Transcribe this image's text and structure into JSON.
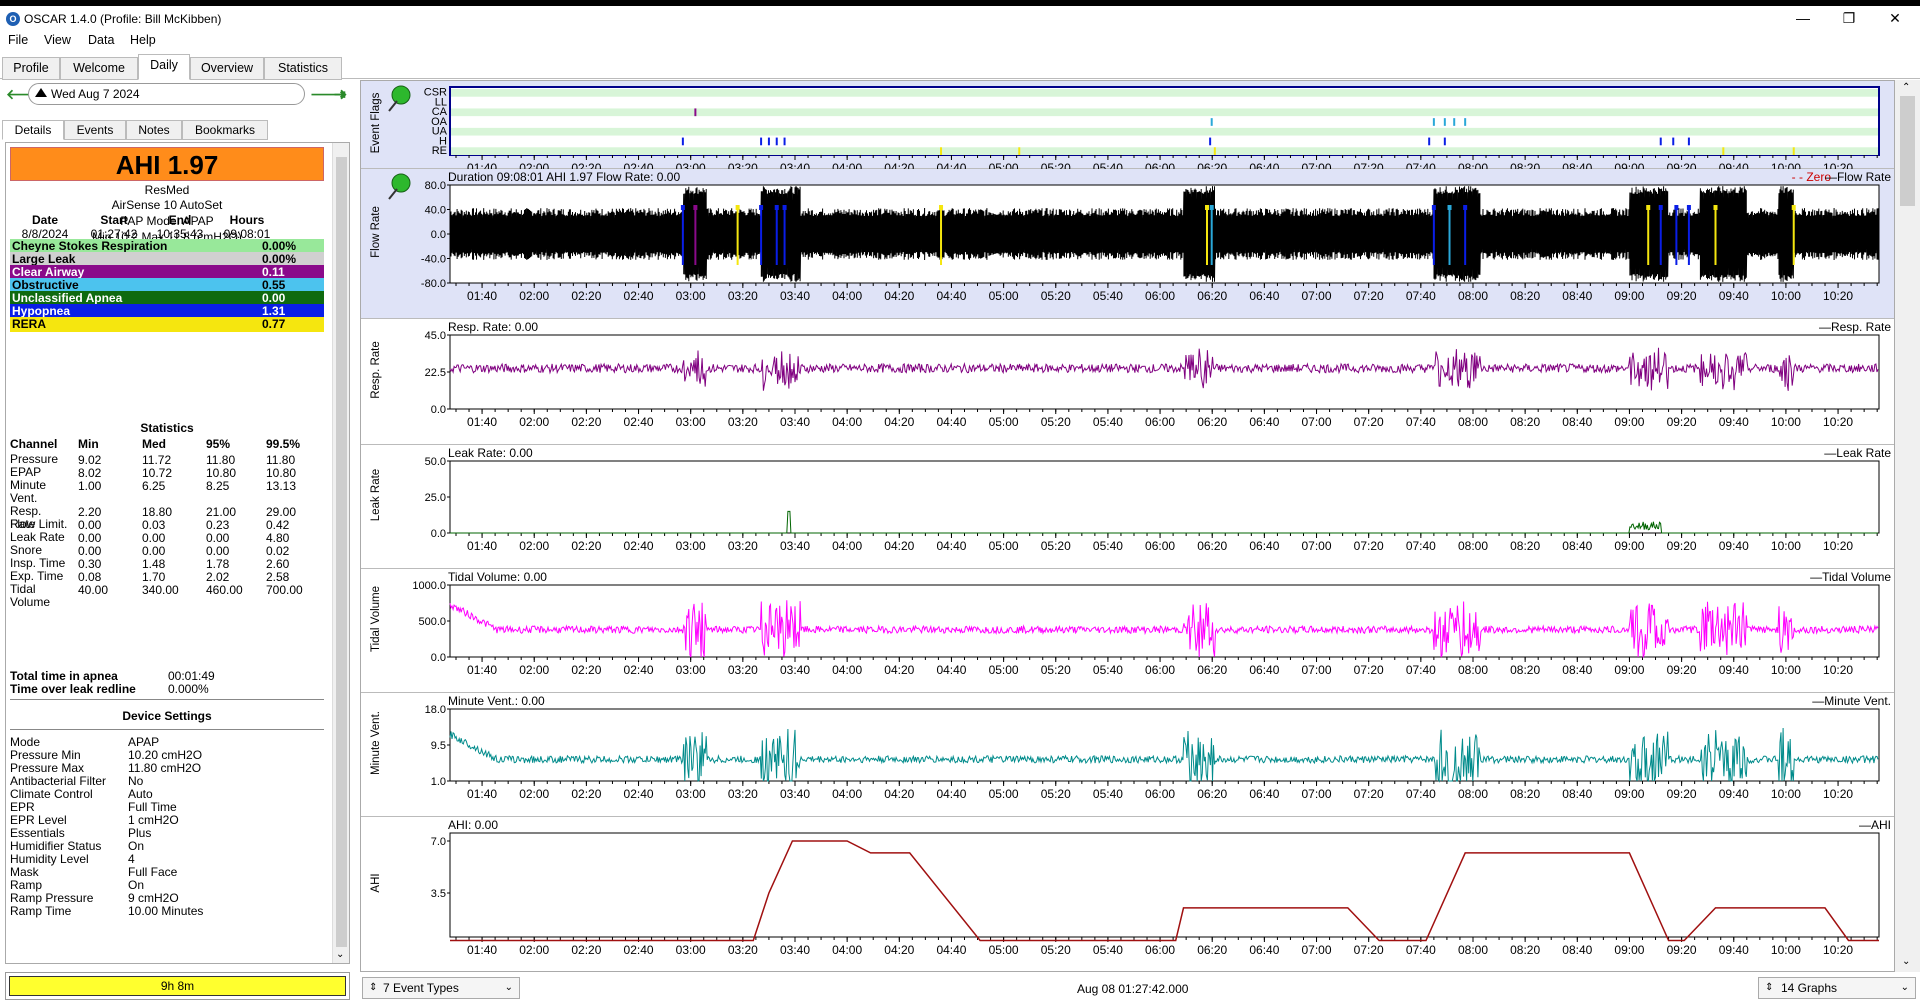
{
  "window": {
    "title": "OSCAR 1.4.0 (Profile: Bill McKibben)",
    "app_icon": "oscar-icon"
  },
  "menu": [
    "File",
    "View",
    "Data",
    "Help"
  ],
  "tabs": [
    "Profile",
    "Welcome",
    "Daily",
    "Overview",
    "Statistics"
  ],
  "active_tab": "Daily",
  "date_nav": {
    "date": "Wed Aug 7 2024"
  },
  "subtabs": [
    "Details",
    "Events",
    "Notes",
    "Bookmarks"
  ],
  "summary": {
    "ahi": "AHI 1.97",
    "manufacturer": "ResMed",
    "model": "AirSense 10 AutoSet",
    "mode": "PAP Mode: APAP",
    "pressure": "Min 10.2 Max 11.8 (cmH2O)"
  },
  "session": {
    "headers": [
      "Date",
      "Start",
      "End",
      "Hours"
    ],
    "values": [
      "8/8/2024",
      "01:27:42",
      "10:35:43",
      "09:08:01"
    ]
  },
  "events": [
    {
      "name": "Cheyne Stokes Respiration",
      "value": "0.00%",
      "bg": "#98e89a",
      "fg": "#000000"
    },
    {
      "name": "Large Leak",
      "value": "0.00%",
      "bg": "#d0d0d0",
      "fg": "#000000"
    },
    {
      "name": "Clear Airway",
      "value": "0.11",
      "bg": "#8a0a8a",
      "fg": "#ffffff"
    },
    {
      "name": "Obstructive",
      "value": "0.55",
      "bg": "#4cc3ee",
      "fg": "#000000"
    },
    {
      "name": "Unclassified Apnea",
      "value": "0.00",
      "bg": "#0f6a0f",
      "fg": "#ffffff"
    },
    {
      "name": "Hypopnea",
      "value": "1.31",
      "bg": "#0a1ee6",
      "fg": "#ffffff"
    },
    {
      "name": "RERA",
      "value": "0.77",
      "bg": "#f5e60f",
      "fg": "#000000"
    }
  ],
  "statistics": {
    "title": "Statistics",
    "headers": [
      "Channel",
      "Min",
      "Med",
      "95%",
      "99.5%"
    ],
    "rows": [
      [
        "Pressure",
        "9.02",
        "11.72",
        "11.80",
        "11.80"
      ],
      [
        "EPAP",
        "8.02",
        "10.72",
        "10.80",
        "10.80"
      ],
      [
        "Minute Vent.",
        "1.00",
        "6.25",
        "8.25",
        "13.13"
      ],
      [
        "Resp. Rate",
        "2.20",
        "18.80",
        "21.00",
        "29.00"
      ],
      [
        "Flow Limit.",
        "0.00",
        "0.03",
        "0.23",
        "0.42"
      ],
      [
        "Leak Rate",
        "0.00",
        "0.00",
        "0.00",
        "4.80"
      ],
      [
        "Snore",
        "0.00",
        "0.00",
        "0.00",
        "0.02"
      ],
      [
        "Insp. Time",
        "0.30",
        "1.48",
        "1.78",
        "2.60"
      ],
      [
        "Exp. Time",
        "0.08",
        "1.70",
        "2.02",
        "2.58"
      ],
      [
        "Tidal Volume",
        "40.00",
        "340.00",
        "460.00",
        "700.00"
      ]
    ]
  },
  "totals": [
    {
      "label": "Total time in apnea",
      "value": "00:01:49"
    },
    {
      "label": "Time over leak redline",
      "value": "0.000%"
    }
  ],
  "device_settings": {
    "title": "Device Settings",
    "rows": [
      [
        "Mode",
        "APAP"
      ],
      [
        "Pressure Min",
        "10.20 cmH2O"
      ],
      [
        "Pressure Max",
        "11.80 cmH2O"
      ],
      [
        "Antibacterial Filter",
        "No"
      ],
      [
        "Climate Control",
        "Auto"
      ],
      [
        "EPR",
        "Full Time"
      ],
      [
        "EPR Level",
        "1 cmH2O"
      ],
      [
        "Essentials",
        "Plus"
      ],
      [
        "Humidifier Status",
        "On"
      ],
      [
        "Humidity Level",
        "4"
      ],
      [
        "Mask",
        "Full Face"
      ],
      [
        "Ramp",
        "On"
      ],
      [
        "Ramp Pressure",
        "9 cmH2O"
      ],
      [
        "Ramp Time",
        "10.00 Minutes"
      ]
    ]
  },
  "duration_bar": "9h 8m",
  "time_axis": [
    "01:40",
    "02:00",
    "02:20",
    "02:40",
    "03:00",
    "03:20",
    "03:40",
    "04:00",
    "04:20",
    "04:40",
    "05:00",
    "05:20",
    "05:40",
    "06:00",
    "06:20",
    "06:40",
    "07:00",
    "07:20",
    "07:40",
    "08:00",
    "08:20",
    "08:40",
    "09:00",
    "09:20",
    "09:40",
    "10:00",
    "10:20"
  ],
  "graphs": [
    {
      "id": "event-flags",
      "ylabel": "Event Flags",
      "title": "",
      "legend": "",
      "flags": [
        "CSR",
        "LL",
        "CA",
        "OA",
        "UA",
        "H",
        "RE"
      ]
    },
    {
      "id": "flow-rate",
      "ylabel": "Flow Rate",
      "title": "Duration 09:08:01 AHI 1.97 Flow Rate: 0.00",
      "legend": "Zero",
      "legend2": "Flow Rate",
      "yticks": [
        "80.0",
        "40.0",
        "0.0",
        "-40.0",
        "-80.0"
      ],
      "color": "#000000"
    },
    {
      "id": "resp-rate",
      "ylabel": "Resp. Rate",
      "title": "Resp. Rate: 0.00",
      "legend": "Resp. Rate",
      "yticks": [
        "45.0",
        "22.5",
        "0.0"
      ],
      "color": "#800080"
    },
    {
      "id": "leak-rate",
      "ylabel": "Leak Rate",
      "title": "Leak Rate: 0.00",
      "legend": "Leak Rate",
      "yticks": [
        "50.0",
        "25.0",
        "0.0"
      ],
      "color": "#006400"
    },
    {
      "id": "tidal-volume",
      "ylabel": "Tidal Volume",
      "title": "Tidal Volume: 0.00",
      "legend": "Tidal Volume",
      "yticks": [
        "1000.0",
        "500.0",
        "0.0"
      ],
      "color": "#ff00ff"
    },
    {
      "id": "minute-vent",
      "ylabel": "Minute Vent.",
      "title": "Minute Vent.: 0.00",
      "legend": "Minute Vent.",
      "yticks": [
        "18.0",
        "9.5",
        "1.0"
      ],
      "color": "#008b8b"
    },
    {
      "id": "ahi",
      "ylabel": "AHI",
      "title": "AHI: 0.00",
      "legend": "AHI",
      "yticks": [
        "7.0",
        "3.5"
      ],
      "color": "#a01010"
    }
  ],
  "bottom": {
    "event_types": "7 Event Types",
    "timestamp": "Aug 08 01:27:42.000",
    "graph_count": "14 Graphs"
  }
}
